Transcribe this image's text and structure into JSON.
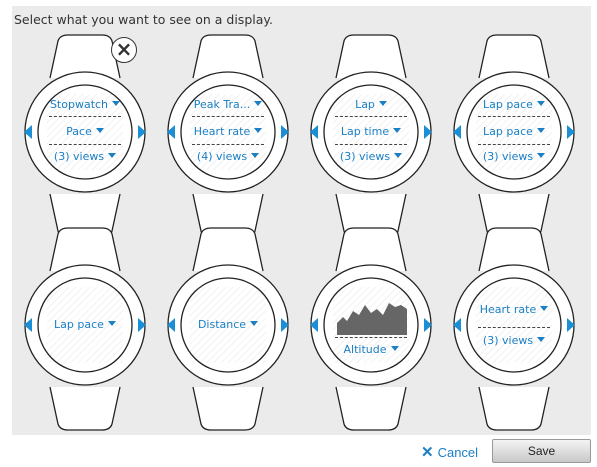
{
  "header": {
    "title": "Select what you want to see on a display."
  },
  "watches": [
    {
      "fields": [
        "Stopwatch",
        "Pace",
        "(3) views"
      ]
    },
    {
      "fields": [
        "Peak Tra...",
        "Heart rate",
        "(4) views"
      ]
    },
    {
      "fields": [
        "Lap",
        "Lap time",
        "(3) views"
      ]
    },
    {
      "fields": [
        "Lap pace",
        "Lap pace",
        "(3) views"
      ]
    },
    {
      "fields": [
        "Lap pace"
      ]
    },
    {
      "fields": [
        "Distance"
      ]
    },
    {
      "chart": "altitude-graph",
      "fields": [
        "Altitude"
      ]
    },
    {
      "fields": [
        "Heart rate",
        "(3) views"
      ]
    }
  ],
  "footer": {
    "cancel_label": "Cancel",
    "cancel_icon": "x-icon",
    "save_label": "Save"
  },
  "colors": {
    "accent": "#1a8fd6",
    "panel": "#ebebeb"
  }
}
